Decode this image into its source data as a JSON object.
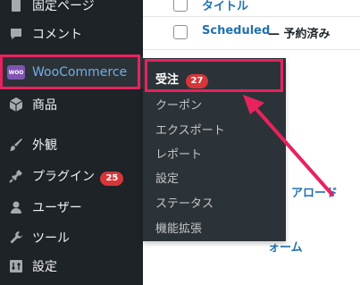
{
  "sidebar": {
    "items": [
      {
        "label": "固定ページ",
        "icon": "pages-icon"
      },
      {
        "label": "コメント",
        "icon": "comment-icon"
      },
      {
        "label": "WooCommerce",
        "icon": "woocommerce-icon",
        "logo_text": "WOO"
      },
      {
        "label": "商品",
        "icon": "box-icon"
      },
      {
        "label": "外観",
        "icon": "paintbrush-icon"
      },
      {
        "label": "プラグイン",
        "icon": "plugin-icon",
        "badge": "25"
      },
      {
        "label": "ユーザー",
        "icon": "user-icon"
      },
      {
        "label": "ツール",
        "icon": "wrench-icon"
      },
      {
        "label": "設定",
        "icon": "settings-icon"
      }
    ]
  },
  "submenu": {
    "items": [
      {
        "label": "受注",
        "badge": "27"
      },
      {
        "label": "クーポン"
      },
      {
        "label": "エクスポート"
      },
      {
        "label": "レポート"
      },
      {
        "label": "設定"
      },
      {
        "label": "ステータス"
      },
      {
        "label": "機能拡張"
      }
    ]
  },
  "main": {
    "rows": [
      {
        "title": "タイトル"
      },
      {
        "title": "Scheduled",
        "status": "— 予約済み"
      }
    ],
    "partial_texts": [
      "アロード",
      "ォーム"
    ]
  },
  "colors": {
    "sidebar_bg": "#1d2327",
    "submenu_bg": "#2c3338",
    "highlight": "#e8225e",
    "link": "#2271b1",
    "badge": "#d63638"
  }
}
